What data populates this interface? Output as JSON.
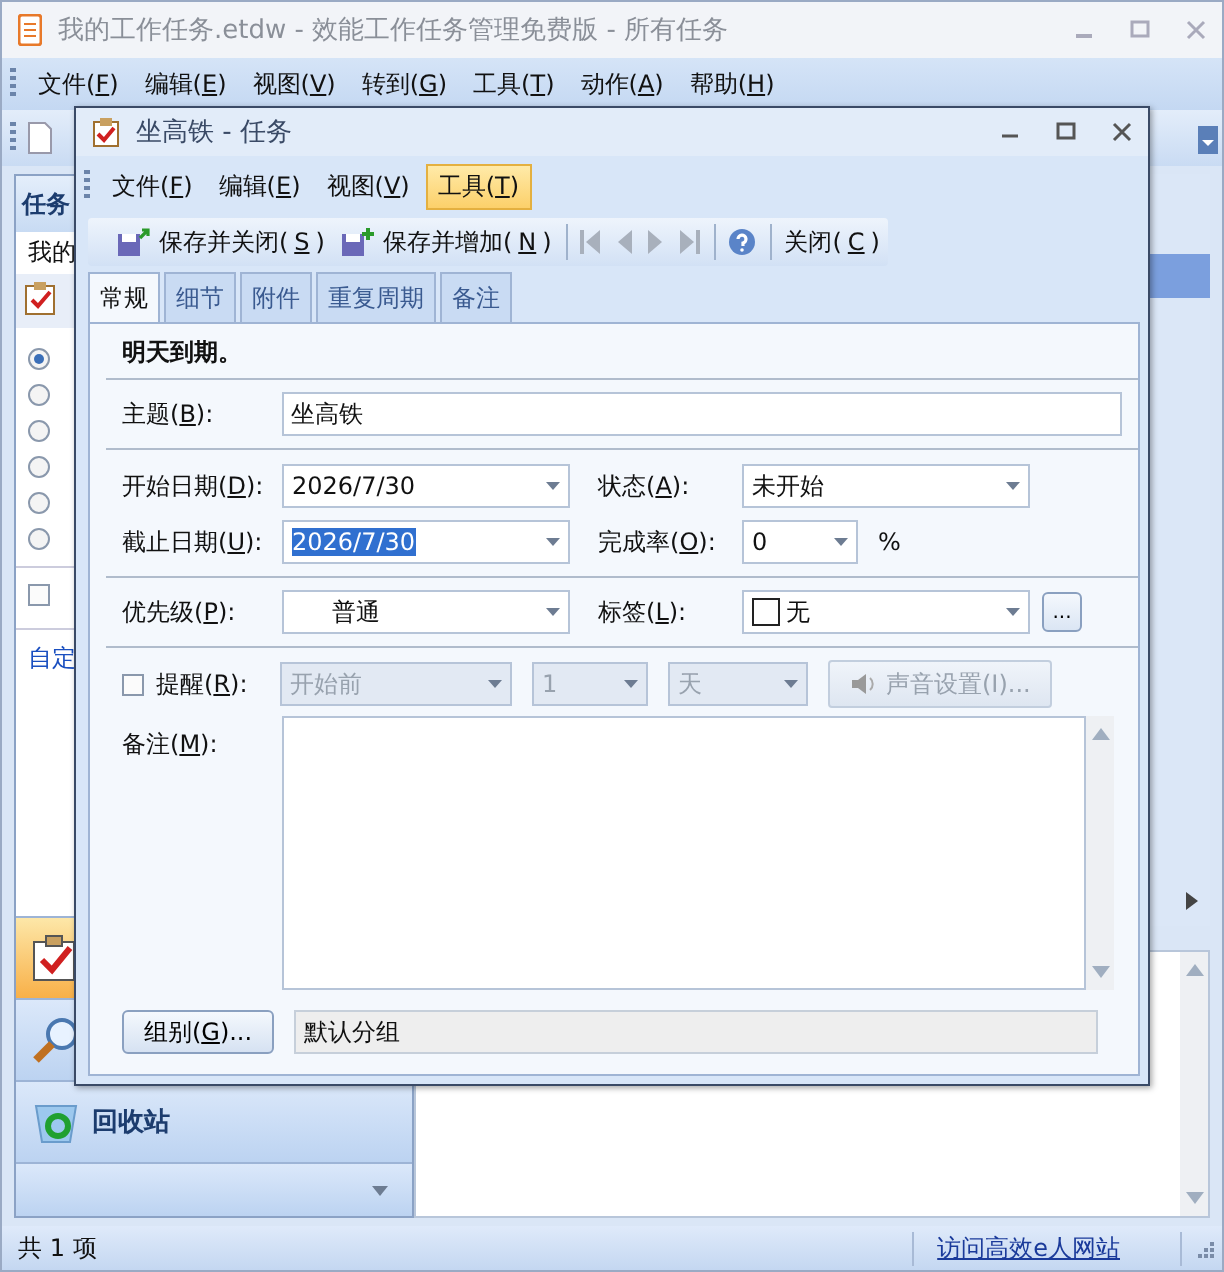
{
  "main_window": {
    "title": "我的工作任务.etdw - 效能工作任务管理免费版 - 所有任务",
    "menu": [
      "文件(F)",
      "编辑(E)",
      "视图(V)",
      "转到(G)",
      "工具(T)",
      "动作(A)",
      "帮助(H)"
    ]
  },
  "sidebar": {
    "header": "任务",
    "subheader": "我的",
    "radios": [
      {
        "selected": true
      },
      {
        "selected": false
      },
      {
        "selected": false
      },
      {
        "selected": false
      },
      {
        "selected": false
      },
      {
        "selected": false
      }
    ],
    "checkbox": {
      "checked": false
    },
    "link": "自定",
    "nav": [
      {
        "kind": "tasks",
        "selected": true
      },
      {
        "kind": "search",
        "selected": false
      },
      {
        "kind": "recycle",
        "label": "回收站",
        "selected": false
      }
    ]
  },
  "status_bar": {
    "count": "共 1 项",
    "link": "访问高效e人网站"
  },
  "dialog": {
    "title": "坐高铁 - 任务",
    "menu": [
      {
        "label": "文件(F)",
        "selected": false
      },
      {
        "label": "编辑(E)",
        "selected": false
      },
      {
        "label": "视图(V)",
        "selected": false
      },
      {
        "label": "工具(T)",
        "selected": true
      }
    ],
    "toolbar": [
      {
        "kind": "save-close",
        "label": "保存并关闭(S)",
        "disabled": false
      },
      {
        "kind": "save-new",
        "label": "保存并增加(N)",
        "disabled": false
      },
      {
        "kind": "first",
        "disabled": true
      },
      {
        "kind": "prev",
        "disabled": true
      },
      {
        "kind": "next",
        "disabled": true
      },
      {
        "kind": "last",
        "disabled": true
      },
      {
        "kind": "help",
        "disabled": false
      },
      {
        "kind": "close",
        "label": "关闭(C)",
        "disabled": false
      }
    ],
    "tabs": [
      {
        "label": "常规",
        "selected": true
      },
      {
        "label": "细节",
        "selected": false
      },
      {
        "label": "附件",
        "selected": false
      },
      {
        "label": "重复周期",
        "selected": false
      },
      {
        "label": "备注",
        "selected": false
      }
    ],
    "notice": "明天到期。",
    "subject": {
      "label": "主题(B):",
      "value": "坐高铁"
    },
    "start_date": {
      "label": "开始日期(D):",
      "value": "2026/7/30"
    },
    "status": {
      "label": "状态(A):",
      "value": "未开始"
    },
    "due_date": {
      "label": "截止日期(U):",
      "value": "2026/7/30",
      "selected": true
    },
    "percent": {
      "label": "完成率(O):",
      "value": "0",
      "unit": "%"
    },
    "priority": {
      "label": "优先级(P):",
      "value": "普通"
    },
    "tag": {
      "label": "标签(L):",
      "value": "无",
      "color": "#ffffff",
      "button": "..."
    },
    "reminder": {
      "label": "提醒(R):",
      "checked": false,
      "when": "开始前",
      "amount": "1",
      "unit": "天",
      "sound_button": "声音设置(I)..."
    },
    "notes": {
      "label": "备注(M):"
    },
    "group": {
      "button": "组别(G)...",
      "value": "默认分组"
    }
  }
}
